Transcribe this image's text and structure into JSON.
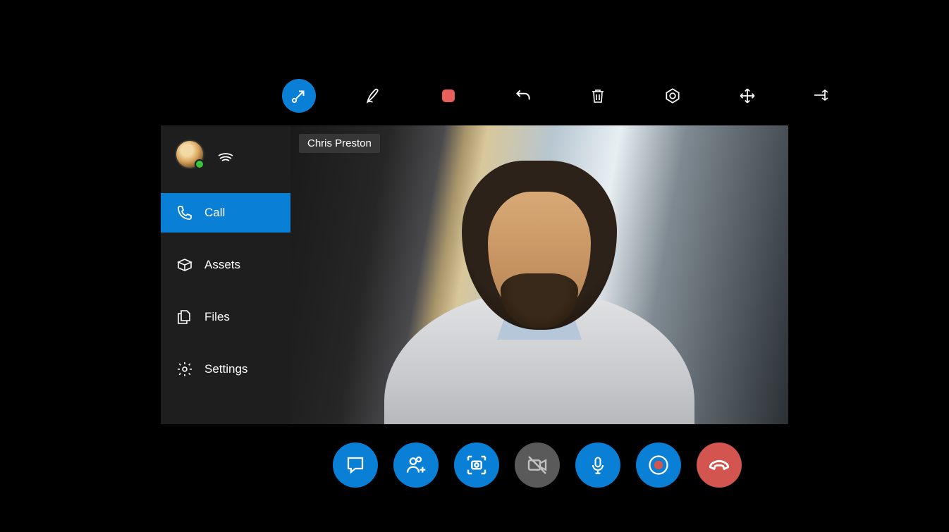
{
  "toolbar": {
    "items": [
      {
        "name": "arrow-ink-tool",
        "active": true
      },
      {
        "name": "pen-ink-tool",
        "active": false
      },
      {
        "name": "stop-record-indicator",
        "active": false
      },
      {
        "name": "undo-tool",
        "active": false
      },
      {
        "name": "delete-tool",
        "active": false
      },
      {
        "name": "hololens-annotate-tool",
        "active": false
      },
      {
        "name": "move-tool",
        "active": false
      },
      {
        "name": "pin-tool",
        "active": false
      }
    ]
  },
  "sidebar": {
    "presence": "online",
    "items": [
      {
        "icon": "phone-icon",
        "label": "Call",
        "selected": true
      },
      {
        "icon": "assets-icon",
        "label": "Assets",
        "selected": false
      },
      {
        "icon": "files-icon",
        "label": "Files",
        "selected": false
      },
      {
        "icon": "settings-icon",
        "label": "Settings",
        "selected": false
      }
    ]
  },
  "call": {
    "participant_name": "Chris Preston"
  },
  "controls": [
    {
      "name": "chat-button",
      "style": "blue",
      "icon": "chat-icon"
    },
    {
      "name": "add-person-button",
      "style": "blue",
      "icon": "add-person-icon"
    },
    {
      "name": "screenshot-button",
      "style": "blue",
      "icon": "camera-capture-icon"
    },
    {
      "name": "camera-toggle-button",
      "style": "grey",
      "icon": "camera-off-icon"
    },
    {
      "name": "mic-toggle-button",
      "style": "blue",
      "icon": "mic-icon"
    },
    {
      "name": "record-button",
      "style": "blue",
      "icon": "record-icon"
    },
    {
      "name": "end-call-button",
      "style": "red",
      "icon": "hang-up-icon"
    }
  ],
  "colors": {
    "accent": "#0a7fd6",
    "danger": "#d2564f",
    "muted": "#5a5a5a",
    "presence_online": "#39c23b"
  }
}
